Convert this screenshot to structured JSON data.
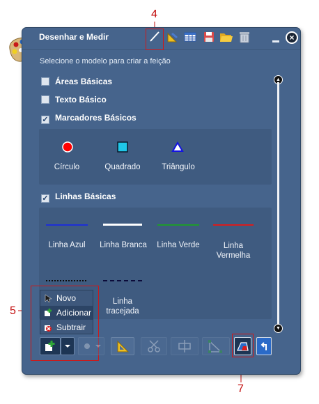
{
  "window": {
    "title": "Desenhar e Medir",
    "close_glyph": "×"
  },
  "toolbar": {
    "icons": [
      "draw-pencil-icon",
      "measure-icon",
      "table-icon",
      "save-icon",
      "open-folder-icon",
      "trash-icon"
    ]
  },
  "prompt": "Selecione o modelo para criar a feição",
  "categories": [
    {
      "label": "Áreas Básicas",
      "checked": false
    },
    {
      "label": "Texto Básico",
      "checked": false
    },
    {
      "label": "Marcadores Básicos",
      "checked": true
    },
    {
      "label": "Linhas Básicas",
      "checked": true
    }
  ],
  "markers": [
    {
      "label": "Círculo",
      "color": "#ff0000",
      "icon": "circle-marker-icon"
    },
    {
      "label": "Quadrado",
      "color": "#1fc7e8",
      "icon": "square-marker-icon"
    },
    {
      "label": "Triângulo",
      "color": "#1414e0",
      "icon": "triangle-marker-icon"
    }
  ],
  "lines": [
    {
      "label": "Linha Azul",
      "color": "#1d2fd6",
      "style": "solid"
    },
    {
      "label": "Linha Branca",
      "color": "#ffffff",
      "style": "solid"
    },
    {
      "label": "Linha Verde",
      "color": "#1e9a2d",
      "style": "solid"
    },
    {
      "label": "Linha Vermelha",
      "color": "#d91c1c",
      "style": "solid"
    },
    {
      "label": "",
      "color": "#0b0b0b",
      "style": "dotted"
    },
    {
      "label": "Linha tracejada",
      "color": "#0b0b3a",
      "style": "dashed"
    }
  ],
  "selection_menu": {
    "items": [
      "Novo",
      "Adicionar",
      "Subtrair"
    ],
    "selected": "Adicionar"
  },
  "bottom_toolbar": {
    "icons": [
      "add-selection-icon",
      "dropdown-arrow-icon",
      "clear-selection-icon",
      "measure-ruler-icon",
      "cut-icon",
      "reshape-icon",
      "union-icon",
      "edit-polygon-icon",
      "undo-icon"
    ]
  },
  "annotations": {
    "callouts": [
      "4",
      "5",
      "7"
    ],
    "color": "#c20c0c"
  }
}
